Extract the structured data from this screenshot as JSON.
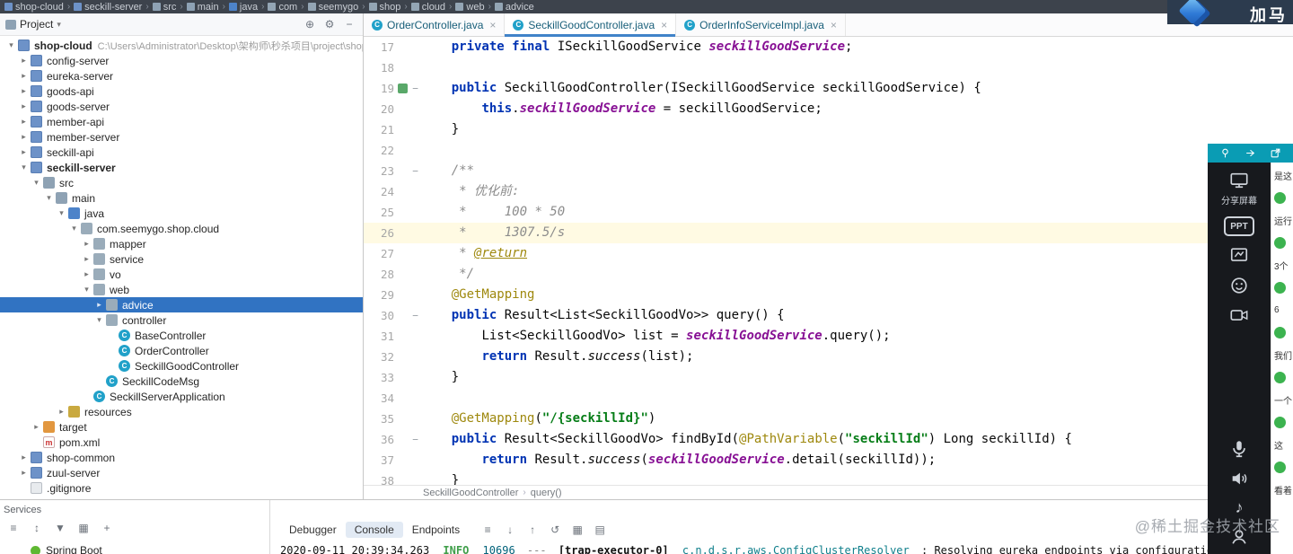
{
  "topbar": {
    "items": [
      {
        "label": "shop-cloud",
        "icon": "module"
      },
      {
        "label": "seckill-server",
        "icon": "module"
      },
      {
        "label": "src",
        "icon": "folder"
      },
      {
        "label": "main",
        "icon": "folder"
      },
      {
        "label": "java",
        "icon": "folder-src"
      },
      {
        "label": "com",
        "icon": "package"
      },
      {
        "label": "seemygo",
        "icon": "package"
      },
      {
        "label": "shop",
        "icon": "package"
      },
      {
        "label": "cloud",
        "icon": "package"
      },
      {
        "label": "web",
        "icon": "package"
      },
      {
        "label": "advice",
        "icon": "package"
      }
    ],
    "brand_text": "加马"
  },
  "project": {
    "title": "Project",
    "tree": [
      {
        "label": "shop-cloud",
        "level": 0,
        "icon": "module",
        "arrow": "down",
        "bold": true,
        "hint": "C:\\Users\\Administrator\\Desktop\\架构师\\秒杀项目\\project\\shop-cloud"
      },
      {
        "label": "config-server",
        "level": 1,
        "icon": "module",
        "arrow": "right"
      },
      {
        "label": "eureka-server",
        "level": 1,
        "icon": "module",
        "arrow": "right"
      },
      {
        "label": "goods-api",
        "level": 1,
        "icon": "module",
        "arrow": "right"
      },
      {
        "label": "goods-server",
        "level": 1,
        "icon": "module",
        "arrow": "right"
      },
      {
        "label": "member-api",
        "level": 1,
        "icon": "module",
        "arrow": "right"
      },
      {
        "label": "member-server",
        "level": 1,
        "icon": "module",
        "arrow": "right"
      },
      {
        "label": "seckill-api",
        "level": 1,
        "icon": "module",
        "arrow": "right"
      },
      {
        "label": "seckill-server",
        "level": 1,
        "icon": "module",
        "arrow": "down",
        "bold": true
      },
      {
        "label": "src",
        "level": 2,
        "icon": "folder",
        "arrow": "down"
      },
      {
        "label": "main",
        "level": 3,
        "icon": "folder",
        "arrow": "down"
      },
      {
        "label": "java",
        "level": 4,
        "icon": "folder-src",
        "arrow": "down"
      },
      {
        "label": "com.seemygo.shop.cloud",
        "level": 5,
        "icon": "package",
        "arrow": "down"
      },
      {
        "label": "mapper",
        "level": 6,
        "icon": "package",
        "arrow": "right"
      },
      {
        "label": "service",
        "level": 6,
        "icon": "package",
        "arrow": "right"
      },
      {
        "label": "vo",
        "level": 6,
        "icon": "package",
        "arrow": "right"
      },
      {
        "label": "web",
        "level": 6,
        "icon": "package",
        "arrow": "down"
      },
      {
        "label": "advice",
        "level": 7,
        "icon": "package",
        "arrow": "right",
        "selected": true
      },
      {
        "label": "controller",
        "level": 7,
        "icon": "package",
        "arrow": "down"
      },
      {
        "label": "BaseController",
        "level": 8,
        "icon": "class",
        "arrow": "none"
      },
      {
        "label": "OrderController",
        "level": 8,
        "icon": "class",
        "arrow": "none"
      },
      {
        "label": "SeckillGoodController",
        "level": 8,
        "icon": "class",
        "arrow": "none"
      },
      {
        "label": "SeckillCodeMsg",
        "level": 7,
        "icon": "class",
        "arrow": "none"
      },
      {
        "label": "SeckillServerApplication",
        "level": 6,
        "icon": "class",
        "arrow": "none"
      },
      {
        "label": "resources",
        "level": 4,
        "icon": "folder-res",
        "arrow": "right"
      },
      {
        "label": "target",
        "level": 2,
        "icon": "folder-target",
        "arrow": "right"
      },
      {
        "label": "pom.xml",
        "level": 2,
        "icon": "file-maven",
        "arrow": "none"
      },
      {
        "label": "shop-common",
        "level": 1,
        "icon": "module",
        "arrow": "right"
      },
      {
        "label": "zuul-server",
        "level": 1,
        "icon": "module",
        "arrow": "right"
      },
      {
        "label": ".gitignore",
        "level": 1,
        "icon": "file",
        "arrow": "none"
      }
    ]
  },
  "editor": {
    "tabs": [
      {
        "label": "OrderController.java",
        "active": false
      },
      {
        "label": "SeckillGoodController.java",
        "active": true
      },
      {
        "label": "OrderInfoServiceImpl.java",
        "active": false
      }
    ],
    "breadcrumb": [
      "SeckillGoodController",
      "query()"
    ],
    "lines": [
      {
        "n": 17,
        "tokens": [
          {
            "t": "    "
          },
          {
            "t": "private final ",
            "c": "k"
          },
          {
            "t": "ISeckillGoodService "
          },
          {
            "t": "seckillGoodService",
            "c": "f"
          },
          {
            "t": ";"
          }
        ]
      },
      {
        "n": 18,
        "tokens": []
      },
      {
        "n": 19,
        "fold": true,
        "mark": true,
        "tokens": [
          {
            "t": "    "
          },
          {
            "t": "public ",
            "c": "k"
          },
          {
            "t": "SeckillGoodController(ISeckillGoodService seckillGoodService) {"
          }
        ]
      },
      {
        "n": 20,
        "tokens": [
          {
            "t": "        "
          },
          {
            "t": "this",
            "c": "k"
          },
          {
            "t": "."
          },
          {
            "t": "seckillGoodService",
            "c": "f"
          },
          {
            "t": " = seckillGoodService;"
          }
        ]
      },
      {
        "n": 21,
        "tokens": [
          {
            "t": "    }"
          }
        ]
      },
      {
        "n": 22,
        "tokens": []
      },
      {
        "n": 23,
        "fold": true,
        "tokens": [
          {
            "t": "    "
          },
          {
            "t": "/**",
            "c": "c"
          }
        ]
      },
      {
        "n": 24,
        "tokens": [
          {
            "t": "     "
          },
          {
            "t": "* 优化前:",
            "c": "c"
          }
        ]
      },
      {
        "n": 25,
        "tokens": [
          {
            "t": "     "
          },
          {
            "t": "*     100 * 50",
            "c": "c"
          }
        ]
      },
      {
        "n": 26,
        "hl": true,
        "tokens": [
          {
            "t": "     "
          },
          {
            "t": "*     1307.5/s",
            "c": "c"
          }
        ]
      },
      {
        "n": 27,
        "tokens": [
          {
            "t": "     "
          },
          {
            "t": "* ",
            "c": "c"
          },
          {
            "t": "@return",
            "c": "ct"
          }
        ]
      },
      {
        "n": 28,
        "tokens": [
          {
            "t": "     "
          },
          {
            "t": "*/",
            "c": "c"
          }
        ]
      },
      {
        "n": 29,
        "tokens": [
          {
            "t": "    "
          },
          {
            "t": "@GetMapping",
            "c": "a"
          }
        ]
      },
      {
        "n": 30,
        "fold": true,
        "tokens": [
          {
            "t": "    "
          },
          {
            "t": "public ",
            "c": "k"
          },
          {
            "t": "Result<List<SeckillGoodVo>> query() {"
          }
        ]
      },
      {
        "n": 31,
        "tokens": [
          {
            "t": "        "
          },
          {
            "t": "List<SeckillGoodVo> list = "
          },
          {
            "t": "seckillGoodService",
            "c": "f"
          },
          {
            "t": ".query();"
          }
        ]
      },
      {
        "n": 32,
        "tokens": [
          {
            "t": "        "
          },
          {
            "t": "return ",
            "c": "k"
          },
          {
            "t": "Result."
          },
          {
            "t": "success",
            "c": "m"
          },
          {
            "t": "(list);"
          }
        ]
      },
      {
        "n": 33,
        "tokens": [
          {
            "t": "    }"
          }
        ]
      },
      {
        "n": 34,
        "tokens": []
      },
      {
        "n": 35,
        "tokens": [
          {
            "t": "    "
          },
          {
            "t": "@GetMapping",
            "c": "a"
          },
          {
            "t": "("
          },
          {
            "t": "\"/{seckillId}\"",
            "c": "s"
          },
          {
            "t": ")"
          }
        ]
      },
      {
        "n": 36,
        "fold": true,
        "tokens": [
          {
            "t": "    "
          },
          {
            "t": "public ",
            "c": "k"
          },
          {
            "t": "Result<SeckillGoodVo> findById("
          },
          {
            "t": "@PathVariable",
            "c": "a"
          },
          {
            "t": "("
          },
          {
            "t": "\"seckillId\"",
            "c": "s"
          },
          {
            "t": ") Long seckillId) {"
          }
        ]
      },
      {
        "n": 37,
        "tokens": [
          {
            "t": "        "
          },
          {
            "t": "return ",
            "c": "k"
          },
          {
            "t": "Result."
          },
          {
            "t": "success",
            "c": "m"
          },
          {
            "t": "("
          },
          {
            "t": "seckillGoodService",
            "c": "f"
          },
          {
            "t": ".detail(seckillId));"
          }
        ]
      },
      {
        "n": 38,
        "tokens": [
          {
            "t": "    }"
          }
        ]
      }
    ]
  },
  "bottom": {
    "tool_tab": "Services",
    "spring_boot": "Spring Boot",
    "service_icons": [
      "list",
      "expand",
      "filter",
      "grid",
      "add"
    ],
    "debug_tabs": [
      {
        "label": "Debugger",
        "active": false
      },
      {
        "label": "Console",
        "active": true
      },
      {
        "label": "Endpoints",
        "active": false
      }
    ],
    "debug_icons": [
      "list",
      "step-down",
      "step-up",
      "rerun",
      "grid",
      "panel"
    ],
    "log": {
      "time": "2020-09-11 20:39:34.263",
      "level": "INFO",
      "pid": "10696",
      "sep": "---",
      "thread": "[trap-executor-0]",
      "logger": "c.n.d.s.r.aws.ConfigClusterResolver",
      "message": ": Resolving eureka endpoints via configuration"
    }
  },
  "overlay": {
    "header_icons": [
      "pin",
      "arrow",
      "share"
    ],
    "tools": [
      {
        "icon": "screen",
        "label": "分享屏幕"
      },
      {
        "icon": "ppt",
        "label": "PPT"
      },
      {
        "icon": "board",
        "label": ""
      },
      {
        "icon": "face",
        "label": ""
      },
      {
        "icon": "camera",
        "label": ""
      },
      {
        "icon": "mic",
        "label": ""
      },
      {
        "icon": "speaker",
        "label": ""
      },
      {
        "icon": "music",
        "label": ""
      },
      {
        "icon": "user",
        "label": ""
      }
    ],
    "chat": [
      {
        "dot": false,
        "text": "是这"
      },
      {
        "dot": true,
        "text": ""
      },
      {
        "dot": false,
        "text": "运行"
      },
      {
        "dot": true,
        "text": ""
      },
      {
        "dot": false,
        "text": "3个"
      },
      {
        "dot": true,
        "text": ""
      },
      {
        "dot": false,
        "text": "6"
      },
      {
        "dot": true,
        "text": ""
      },
      {
        "dot": false,
        "text": "我们"
      },
      {
        "dot": true,
        "text": ""
      },
      {
        "dot": false,
        "text": "一个"
      },
      {
        "dot": true,
        "text": ""
      },
      {
        "dot": false,
        "text": "这"
      },
      {
        "dot": true,
        "text": ""
      },
      {
        "dot": false,
        "text": "看着"
      }
    ]
  },
  "watermark": "@稀土掘金技术社区"
}
